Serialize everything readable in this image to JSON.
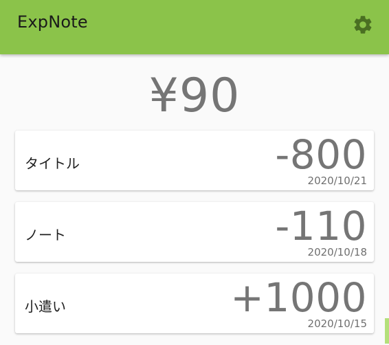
{
  "app_bar": {
    "title": "ExpNote",
    "settings_icon": "gear-icon",
    "color": "#8bc34a"
  },
  "balance": {
    "display": "¥90"
  },
  "entries": [
    {
      "title": "タイトル",
      "amount": "-800",
      "date": "2020/10/21"
    },
    {
      "title": "ノート",
      "amount": "-110",
      "date": "2020/10/18"
    },
    {
      "title": "小遣い",
      "amount": "+1000",
      "date": "2020/10/15"
    }
  ],
  "colors": {
    "accent": "#8bc34a",
    "amount_text": "#757575",
    "background": "#fafafa"
  }
}
